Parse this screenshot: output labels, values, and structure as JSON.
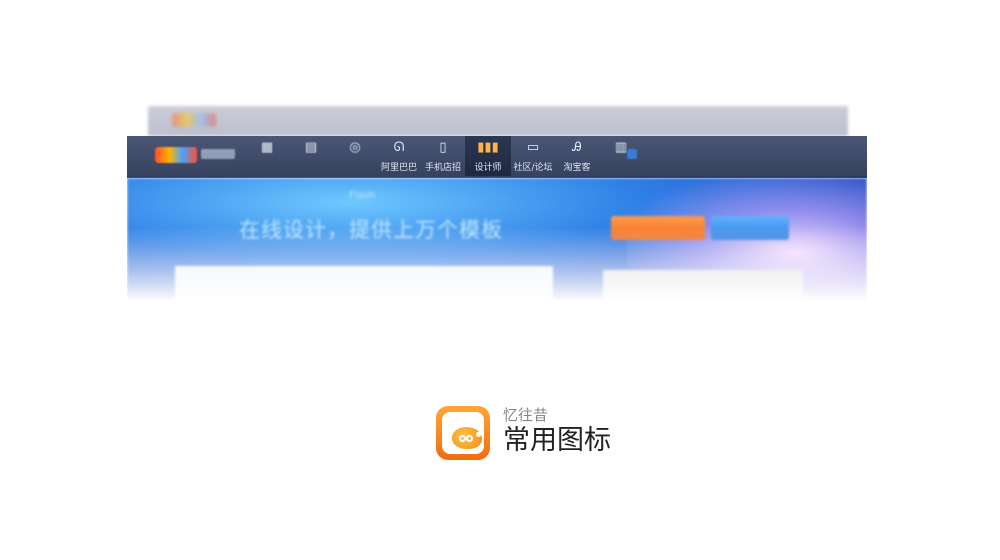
{
  "nav": {
    "items": [
      {
        "label": "",
        "icon": "calendar-icon"
      },
      {
        "label": "",
        "icon": "document-icon"
      },
      {
        "label": "",
        "icon": "target-icon"
      },
      {
        "label": "阿里巴巴",
        "icon": "alibaba-icon"
      },
      {
        "label": "手机店招",
        "icon": "phone-icon"
      },
      {
        "label": "设计师",
        "icon": "designer-icon",
        "active": true
      },
      {
        "label": "社区/论坛",
        "icon": "forum-icon"
      },
      {
        "label": "淘宝客",
        "icon": "taoke-icon"
      },
      {
        "label": "",
        "icon": "card-icon"
      }
    ]
  },
  "banner": {
    "headline": "在线设计，提供上万个模板",
    "tag": "Flash"
  },
  "brand": {
    "subtitle": "忆往昔",
    "title": "常用图标"
  },
  "colors": {
    "navbar": "#3d4968",
    "accent_orange": "#f57a1f",
    "accent_blue": "#3a8ae6"
  }
}
